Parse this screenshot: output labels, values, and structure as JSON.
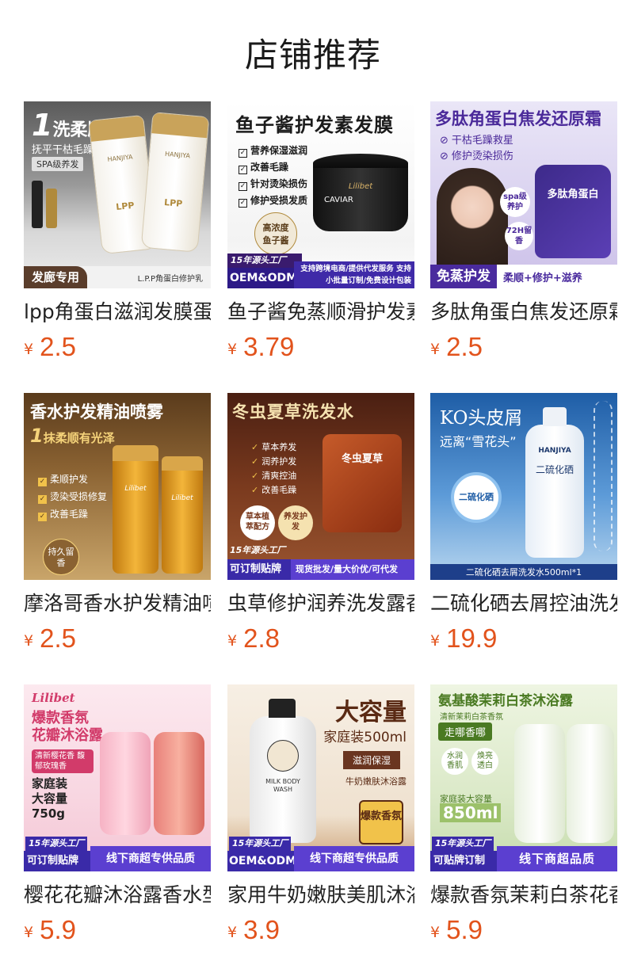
{
  "page": {
    "title": "店铺推荐"
  },
  "products": [
    {
      "name": "lpp角蛋白滋润发膜蛋白修护乳",
      "currency": "¥",
      "price": "2.5",
      "thumb": {
        "headline": "洗柔顺",
        "headline_num": "1",
        "sub1": "抚平干枯毛躁",
        "sub2": "SPA级养发",
        "brand": "HANJIYA",
        "pack_text": "LPP",
        "tag_left": "发廊专用",
        "tag_right": "L.P.P角蛋白修护乳"
      }
    },
    {
      "name": "鱼子酱免蒸顺滑护发素发膜",
      "currency": "¥",
      "price": "3.79",
      "thumb": {
        "headline": "鱼子酱护发素发膜",
        "points": [
          "营养保湿滋润",
          "改善毛躁",
          "针对烫染损伤",
          "修护受损发质"
        ],
        "jar_brand": "Lilibet",
        "jar_label": "CAVIAR",
        "badge": "高浓度鱼子酱",
        "factory": "15年源头工厂",
        "oem": "OEM&ODM",
        "services": "支持跨境电商/提供代发服务 支持小批量订制/免费设计包装"
      }
    },
    {
      "name": "多肽角蛋白焦发还原霜修护",
      "currency": "¥",
      "price": "2.5",
      "thumb": {
        "headline": "多肽角蛋白焦发还原霜",
        "points": [
          "干枯毛躁救星",
          "修护烫染损伤"
        ],
        "bubble": "spa级养护",
        "hours": "72H留香",
        "pack_title": "多肽角蛋白",
        "tag_left": "免蒸护发",
        "tag_right": "柔顺+修护+滋养"
      }
    },
    {
      "name": "摩洛哥香水护发精油喷雾",
      "currency": "¥",
      "price": "2.5",
      "thumb": {
        "headline": "香水护发精油喷雾",
        "sub": "抹柔顺有光泽",
        "sub_num": "1",
        "points": [
          "柔顺护发",
          "烫染受损修复",
          "改善毛躁"
        ],
        "badge": "持久留香",
        "brand": "Lilibet"
      }
    },
    {
      "name": "虫草修护润养洗发露香氛",
      "currency": "¥",
      "price": "2.8",
      "thumb": {
        "headline": "冬虫夏草洗发水",
        "points": [
          "草本养发",
          "润养护发",
          "清爽控油",
          "改善毛躁"
        ],
        "badge1": "草本植萃配方",
        "badge2": "养发护发",
        "pack_text": "冬虫夏草",
        "factory": "15年源头工厂",
        "custom": "可订制贴牌",
        "services": "现货批发/量大价优/可代发"
      }
    },
    {
      "name": "二硫化硒去屑控油洗发水",
      "currency": "¥",
      "price": "19.9",
      "thumb": {
        "headline": "KO头皮屑",
        "sub": "远离“雪花头”",
        "brand": "HANJIYA",
        "bottle_text": "二硫化硒",
        "circle": "二硫化硒",
        "footer": "二硫化硒去屑洗发水500ml*1"
      }
    },
    {
      "name": "樱花花瓣沐浴露香水型",
      "currency": "¥",
      "price": "5.9",
      "thumb": {
        "brand": "Lilibet",
        "headline1": "爆款香氛",
        "headline2": "花瓣沐浴露",
        "tag": "清新樱花香 馥郁玫瑰香",
        "size1": "家庭装",
        "size2": "大容量",
        "size3": "750g",
        "factory": "15年源头工厂",
        "custom": "可订制贴牌",
        "offline": "线下商超专供品质"
      }
    },
    {
      "name": "家用牛奶嫩肤美肌沐浴露",
      "currency": "¥",
      "price": "3.9",
      "thumb": {
        "headline": "大容量",
        "sub": "家庭装500ml",
        "chip1": "滋润保湿",
        "chip2": "牛奶嫩肤沐浴露",
        "bottle_text": "MILK BODY WASH",
        "badge": "爆款香氛",
        "factory": "15年源头工厂",
        "oem": "OEM&ODM",
        "offline": "线下商超专供品质"
      }
    },
    {
      "name": "爆款香氛茉莉白茶花香沐浴露",
      "currency": "¥",
      "price": "5.9",
      "thumb": {
        "headline": "氨基酸茉莉白茶沐浴露",
        "sub": "清新茉莉白茶香氛",
        "chip": "走哪香哪",
        "circle1": "水润香肌",
        "circle2": "焕亮透白",
        "size": "家庭装大容量",
        "volume": "850ml",
        "factory": "15年源头工厂",
        "custom": "可贴牌订制",
        "offline": "线下商超品质"
      }
    }
  ]
}
